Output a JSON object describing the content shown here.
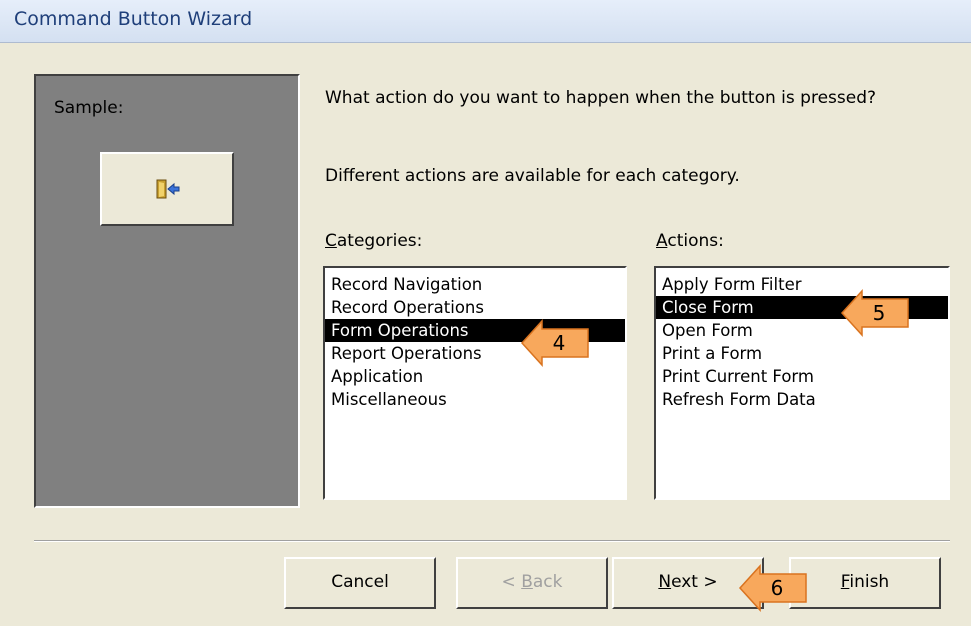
{
  "window": {
    "title": "Command Button Wizard"
  },
  "sample": {
    "label": "Sample:",
    "icon": "close-form-door-icon"
  },
  "prompt": {
    "question": "What action do you want to happen when the button is pressed?",
    "hint": "Different actions are available for each category."
  },
  "categories": {
    "label": "Categories:",
    "items": [
      "Record Navigation",
      "Record Operations",
      "Form Operations",
      "Report Operations",
      "Application",
      "Miscellaneous"
    ],
    "selected": "Form Operations"
  },
  "actions": {
    "label": "Actions:",
    "items": [
      "Apply Form Filter",
      "Close Form",
      "Open Form",
      "Print a Form",
      "Print Current Form",
      "Refresh Form Data"
    ],
    "selected": "Close Form"
  },
  "buttons": {
    "cancel": "Cancel",
    "back": "< Back",
    "next": "Next >",
    "finish": "Finish"
  },
  "callouts": [
    "4",
    "5",
    "6"
  ],
  "colors": {
    "callout_fill": "#f8a85c",
    "callout_stroke": "#d9731f",
    "selection": "#000000"
  }
}
